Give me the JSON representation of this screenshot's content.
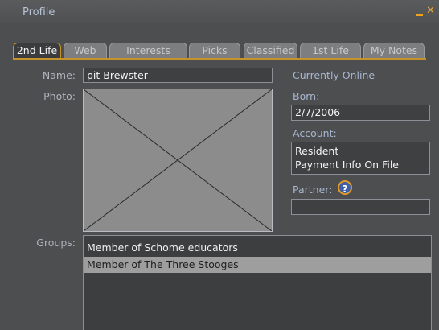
{
  "window": {
    "title": "Profile"
  },
  "tabs": [
    "2nd Life",
    "Web",
    "Interests",
    "Picks",
    "Classified",
    "1st Life",
    "My Notes"
  ],
  "labels": {
    "name": "Name:",
    "photo": "Photo:",
    "groups": "Groups:",
    "online_status": "Currently Online",
    "born": "Born:",
    "account": "Account:",
    "partner": "Partner:"
  },
  "values": {
    "name": "pit Brewster",
    "born": "2/7/2006",
    "account_line1": "Resident",
    "account_line2": "Payment Info On File",
    "partner": ""
  },
  "groups": [
    "Member of Schome educators",
    "Member of The Three Stooges"
  ],
  "icons": {
    "help": "?"
  },
  "colors": {
    "accent": "#c8922a",
    "background": "#4d4e50",
    "selected_row": "#9e9e9e"
  }
}
